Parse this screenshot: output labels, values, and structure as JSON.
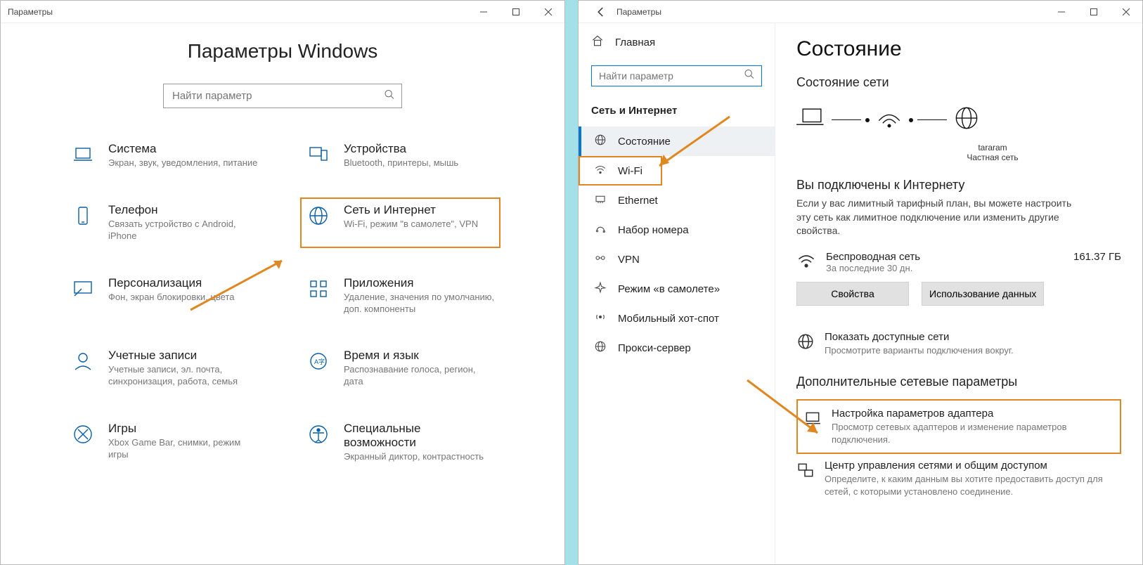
{
  "left": {
    "window_title": "Параметры",
    "heading": "Параметры Windows",
    "search_placeholder": "Найти параметр",
    "categories": [
      {
        "title": "Система",
        "desc": "Экран, звук, уведомления, питание",
        "icon": "laptop"
      },
      {
        "title": "Устройства",
        "desc": "Bluetooth, принтеры, мышь",
        "icon": "devices"
      },
      {
        "title": "Телефон",
        "desc": "Связать устройство с Android, iPhone",
        "icon": "phone"
      },
      {
        "title": "Сеть и Интернет",
        "desc": "Wi-Fi, режим \"в самолете\", VPN",
        "icon": "globe",
        "highlight": true
      },
      {
        "title": "Персонализация",
        "desc": "Фон, экран блокировки, цвета",
        "icon": "personalize"
      },
      {
        "title": "Приложения",
        "desc": "Удаление, значения по умолчанию, доп. компоненты",
        "icon": "apps"
      },
      {
        "title": "Учетные записи",
        "desc": "Учетные записи, эл. почта, синхронизация, работа, семья",
        "icon": "account"
      },
      {
        "title": "Время и язык",
        "desc": "Распознавание голоса, регион, дата",
        "icon": "time"
      },
      {
        "title": "Игры",
        "desc": "Xbox Game Bar, снимки, режим игры",
        "icon": "games"
      },
      {
        "title": "Специальные возможности",
        "desc": "Экранный диктор, контрастность",
        "icon": "access"
      }
    ]
  },
  "right": {
    "window_title": "Параметры",
    "home_label": "Главная",
    "search_placeholder": "Найти параметр",
    "section_label": "Сеть и Интернет",
    "nav": [
      {
        "label": "Состояние",
        "icon": "globe-status",
        "selected": true
      },
      {
        "label": "Wi-Fi",
        "icon": "wifi",
        "boxed": true
      },
      {
        "label": "Ethernet",
        "icon": "ethernet"
      },
      {
        "label": "Набор номера",
        "icon": "dialup"
      },
      {
        "label": "VPN",
        "icon": "vpn"
      },
      {
        "label": "Режим «в самолете»",
        "icon": "airplane"
      },
      {
        "label": "Мобильный хот-спот",
        "icon": "hotspot"
      },
      {
        "label": "Прокси-сервер",
        "icon": "globe-proxy"
      }
    ],
    "page_title": "Состояние",
    "status_heading": "Состояние сети",
    "diagram": {
      "ssid": "tararam",
      "net_type": "Частная сеть"
    },
    "connected_title": "Вы подключены к Интернету",
    "connected_desc": "Если у вас лимитный тарифный план, вы можете настроить эту сеть как лимитное подключение или изменить другие свойства.",
    "usage": {
      "name": "Беспроводная сеть",
      "period": "За последние 30 дн.",
      "amount": "161.37 ГБ"
    },
    "btn_props": "Свойства",
    "btn_usage": "Использование данных",
    "available": {
      "title": "Показать доступные сети",
      "desc": "Просмотрите варианты подключения вокруг."
    },
    "adv_heading": "Дополнительные сетевые параметры",
    "adapter": {
      "title": "Настройка параметров адаптера",
      "desc": "Просмотр сетевых адаптеров и изменение параметров подключения."
    },
    "sharing": {
      "title": "Центр управления сетями и общим доступом",
      "desc": "Определите, к каким данным вы хотите предоставить доступ для сетей, с которыми установлено соединение."
    }
  }
}
